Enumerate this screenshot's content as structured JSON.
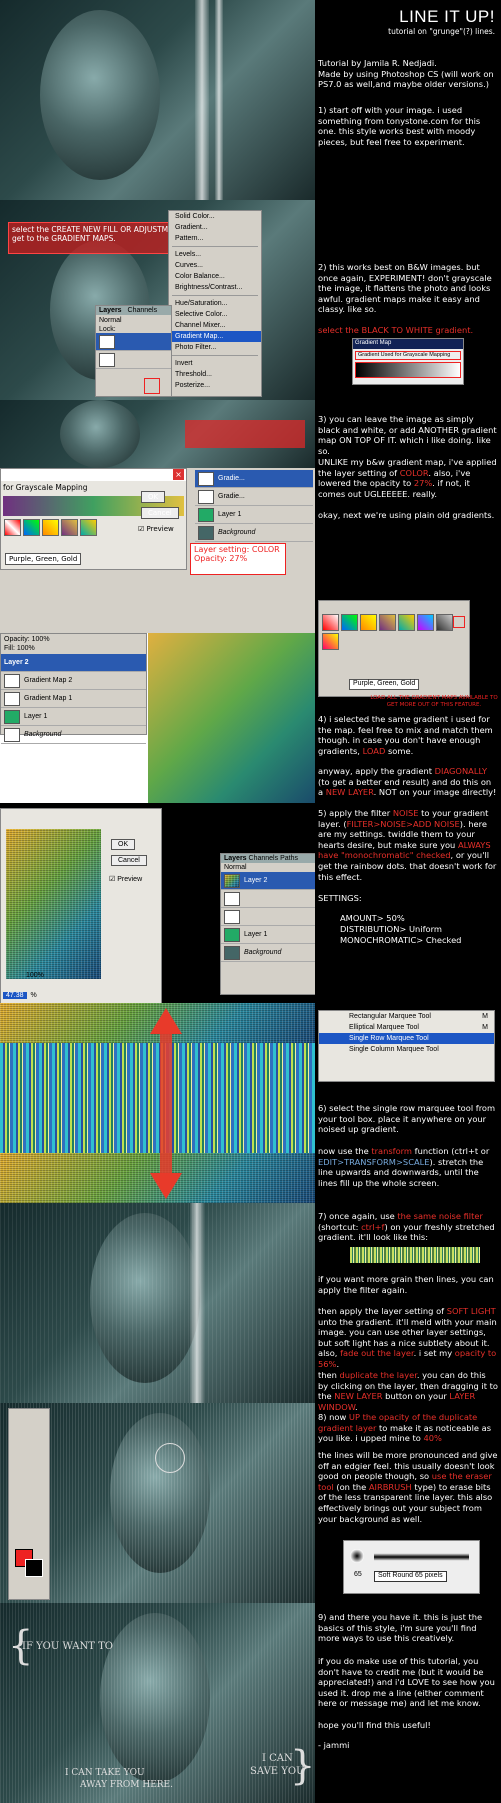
{
  "header": {
    "title": "LINE IT UP!",
    "subtitle": "tutorial on \"grunge\"(?) lines."
  },
  "credits": {
    "line1": "Tutorial by Jamila R. Nedjadi.",
    "line2": "Made by using Photoshop CS (will work on PS7.0 as well,and maybe older versions.)"
  },
  "steps": {
    "s1": "1) start off with your image. i used something from tonystone.com for this one. this style works best with moody pieces, but feel free to experiment.",
    "s2": "2) this works best on B&W images. but once again, EXPERIMENT! don't grayscale the image, it flattens the photo and looks awful. gradient maps make it easy and classy. like so.",
    "s2_select": "select the BLACK TO WHITE gradient.",
    "s3a": "3) you can leave the image as simply black and white, or add ANOTHER gradient map ON TOP OF IT. which i like doing. like so.",
    "s3b_pre": "UNLIKE my b&w gradient map, i've applied the layer setting of ",
    "s3b_color": "COLOR",
    "s3b_mid": ". also, i've lowered the opacity to ",
    "s3b_opacity": "27%",
    "s3b_post": ". if not, it comes out UGLEEEEE. really.",
    "s3c": "okay, next we're using plain old gradients.",
    "s4a_pre": "4) i selected the same gradient i used for the map. feel free to mix and match them though. in case you don't have enough gradients, ",
    "s4a_load": "LOAD",
    "s4a_post": " some.",
    "s4b_pre": "anyway, apply the gradient ",
    "s4b_diag": "DIAGONALLY",
    "s4b_mid": " (to get a better end result) and do this on a ",
    "s4b_newlayer": "NEW LAYER",
    "s4b_post": ". NOT on your image directly!",
    "s5_pre": "5) apply the filter ",
    "s5_noise": "NOISE",
    "s5_mid": " to your gradient layer. (",
    "s5_path": "FILTER>NOISE>ADD NOISE",
    "s5_mid2": "). here are my settings. twiddle them to your hearts desire, but make sure you ",
    "s5_always": "ALWAYS have \"monochromatic\" checked",
    "s5_post": ", or you'll get the rainbow dots. that doesn't work for this effect.",
    "settings_label": "SETTINGS:",
    "settings": [
      "AMOUNT> 50%",
      "DISTRIBUTION> Uniform",
      "MONOCHROMATIC> Checked"
    ],
    "s6a": "6) select the single row marquee tool from your tool box. place it anywhere on your noised up gradient.",
    "s6b_pre": "now use the ",
    "s6b_transform": "transform",
    "s6b_mid": " function (ctrl+t or ",
    "s6b_path": "EDIT>TRANSFORM>SCALE",
    "s6b_post": "). stretch the line upwards and downwards, until the lines fill up the whole screen.",
    "s7a_pre": "7) once again, use ",
    "s7a_same": "the same noise filter",
    "s7a_mid": " (shortcut: ",
    "s7a_ctrl": "ctrl+f",
    "s7a_post": ") on your freshly stretched gradient. it'll look like this:",
    "s7b": "if you want more grain then lines, you can apply the filter again.",
    "s7c_pre": "then apply the layer setting of ",
    "s7c_soft": "SOFT LIGHT",
    "s7c_mid": " unto the gradient. it'll meld with your main image. you can use other layer settings, but soft light has a nice subtlety about it. also, ",
    "s7c_fade": "fade out the layer",
    "s7c_mid2": ". i set my ",
    "s7c_op": "opacity to 56%",
    "s7c_post": ".",
    "s7d_pre": "then ",
    "s7d_dup": "duplicate the layer",
    "s7d_mid": ". you can do this by clicking on the layer, then dragging it to the ",
    "s7d_new": "NEW LAYER",
    "s7d_mid2": " button on your ",
    "s7d_win": "LAYER WINDOW",
    "s7d_post": ".",
    "s8a_pre": "8) now ",
    "s8a_up": "UP the opacity of the duplicate gradient layer",
    "s8a_mid": " to make it as noticeable as you like. i upped mine to ",
    "s8a_40": "40%",
    "s8b_pre": "the lines will be more pronounced and give off an edgier feel. this usually doesn't look good on people though, so ",
    "s8b_eraser": "use the eraser tool",
    "s8b_mid": " (on the ",
    "s8b_air": "AIRBRUSH",
    "s8b_post": " type) to erase bits of the less transparent line layer. this also effectively brings out your subject from your background as well.",
    "s9": "9) and there you have it. this is just the basics of this style, i'm sure you'll find more ways to use this creatively.",
    "s9b": "if you do make use of this tutorial, you don't have to credit me (but it would be appreciated!) and i'd LOVE to see how you used it. drop me a line (either comment here or message me) and let me know.",
    "s9c": "hope you'll find this useful!",
    "sign": "- jammi"
  },
  "ui": {
    "step2_banner": "select the CREATE NEW FILL OR ADJUSTMENT LAYER to get to the GRADIENT MAPS.",
    "menu": [
      "Solid Color...",
      "Gradient...",
      "Pattern...",
      "Levels...",
      "Curves...",
      "Color Balance...",
      "Brightness/Contrast...",
      "Hue/Saturation...",
      "Selective Color...",
      "Channel Mixer...",
      "Gradient Map...",
      "Photo Filter...",
      "Invert",
      "Threshold...",
      "Posterize..."
    ],
    "menu_selected_index": 10,
    "layers_tab": "Layers",
    "channels_tab": "Channels",
    "paths_tab": "Paths",
    "blend_normal": "Normal",
    "opacity_label": "Opacity:",
    "opacity_value": "100%",
    "fill_label": "Fill:",
    "fill_value": "100%",
    "lock_label": "Lock:",
    "gradient_bar_title": "Gradient Map",
    "gradient_bar_sub": "Gradient Used for Grayscale Mapping",
    "dialog_title": "for Grayscale Mapping",
    "ok": "OK",
    "cancel": "Cancel",
    "preview": "Preview",
    "gradient_name": "Purple, Green, Gold",
    "layer_setting_line1": "Layer setting: COLOR",
    "layer_setting_line2": "Opacity: 27%",
    "layer2": "Layer 2",
    "gm2": "Gradient Map 2",
    "gm1": "Gradient Map 1",
    "layer1": "Layer 1",
    "background": "Background",
    "gradie": "Gradie...",
    "load_caption": "LOAD ALL THE GRADIENT MAPS AVAILABLE TO GET MORE OUT OF THIS FEATURE.",
    "noise_zoom": "100%",
    "noise_amount": "47.38",
    "percent": "%",
    "marquee": [
      "Rectangular Marquee Tool",
      "Elliptical Marquee Tool",
      "Single Row Marquee Tool",
      "Single Column Marquee Tool"
    ],
    "marquee_key": "M",
    "brush_size": "65",
    "brush_label": "Soft Round 65 pixels",
    "caption_if": "IF YOU WANT TO",
    "caption_take1": "I CAN TAKE YOU",
    "caption_take2": "AWAY FROM HERE.",
    "caption_save1": "I CAN",
    "caption_save2": "SAVE YOU"
  }
}
